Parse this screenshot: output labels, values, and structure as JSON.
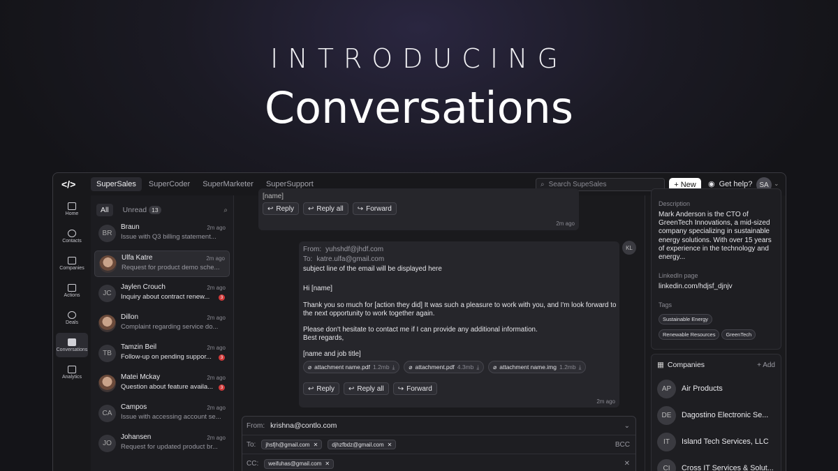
{
  "hero": {
    "eyebrow": "INTRODUCING",
    "title": "Conversations"
  },
  "topbar": {
    "logo": "</>",
    "tabs": [
      "SuperSales",
      "SuperCoder",
      "SuperMarketer",
      "SuperSupport"
    ],
    "search_placeholder": "Search SupeSales",
    "new_label": "New",
    "help_label": "Get help?",
    "avatar": "SA"
  },
  "sidebar": [
    "Home",
    "Contacts",
    "Companies",
    "Actions",
    "Deals",
    "Conversations",
    "Analytics"
  ],
  "list": {
    "filter_all": "All",
    "filter_unread": "Unread",
    "unread_count": "13",
    "items": [
      {
        "initials": "BR",
        "name": "Braun",
        "time": "2m ago",
        "preview": "Issue with Q3 billing statement..."
      },
      {
        "initials": "",
        "name": "Ulfa Katre",
        "time": "2m ago",
        "preview": "Request for product demo sche..."
      },
      {
        "initials": "JC",
        "name": "Jaylen Crouch",
        "time": "2m ago",
        "preview": "Inquiry about contract renew...",
        "unread": "3"
      },
      {
        "initials": "",
        "name": "Dillon",
        "time": "2m ago",
        "preview": "Complaint regarding service do..."
      },
      {
        "initials": "TB",
        "name": "Tamzin Beil",
        "time": "2m ago",
        "preview": "Follow-up on pending suppor...",
        "unread": "3"
      },
      {
        "initials": "",
        "name": "Matei Mckay",
        "time": "2m ago",
        "preview": "Question about feature availa...",
        "unread": "3"
      },
      {
        "initials": "CA",
        "name": "Campos",
        "time": "2m ago",
        "preview": "Issue with accessing account se..."
      },
      {
        "initials": "JO",
        "name": "Johansen",
        "time": "2m ago",
        "preview": "Request for updated product br..."
      }
    ]
  },
  "thread": {
    "top_partial": "[name]",
    "reply": "Reply",
    "reply_all": "Reply all",
    "forward": "Forward",
    "time1": "2m ago",
    "msg": {
      "avatar": "KL",
      "from_label": "From:",
      "from": "yuhshdf@jhdf.com",
      "to_label": "To:",
      "to": "katre.ulfa@gmail.com",
      "subject": "subject line of the email will be displayed here",
      "greeting": "Hi [name]",
      "body1": "Thank you so much for [action they did] It was such a pleasure to work with you, and I'm look forward to the next opportunity to work together again.",
      "body2": "Please don't hesitate to contact me if I can provide any additional information.",
      "signoff": "Best regards,",
      "signature": "[name and job title]",
      "attachments": [
        {
          "name": "attachment name.pdf",
          "size": "1.2mb"
        },
        {
          "name": "attachment.pdf",
          "size": "4.3mb"
        },
        {
          "name": "attachment name.img",
          "size": "1.2mb"
        }
      ],
      "time": "2m ago"
    },
    "compose": {
      "from_label": "From:",
      "from": "krishna@contlo.com",
      "to_label": "To:",
      "to": [
        "jhsfjh@gmail.com",
        "djhzfbdz@gmail.com"
      ],
      "bcc": "BCC",
      "cc_label": "CC:",
      "cc": [
        "weifuhas@gmail.com"
      ]
    }
  },
  "details": {
    "description_label": "Description",
    "description": "Mark Anderson is the CTO of GreenTech Innovations, a mid-sized company specializing in sustainable energy solutions. With over 15 years of experience in the technology and energy...",
    "linkedin_label": "LinkedIn page",
    "linkedin": "linkedin.com/hdjsf_djnjv",
    "tags_label": "Tags",
    "tags": [
      "Sustainable Energy",
      "Renewable Resources",
      "GreenTech"
    ],
    "companies_label": "Companies",
    "add_label": "Add",
    "companies": [
      {
        "initials": "AP",
        "name": "Air Products"
      },
      {
        "initials": "DE",
        "name": "Dagostino Electronic Se..."
      },
      {
        "initials": "IT",
        "name": "Island Tech Services, LLC"
      },
      {
        "initials": "CI",
        "name": "Cross IT Services & Solut..."
      }
    ]
  }
}
